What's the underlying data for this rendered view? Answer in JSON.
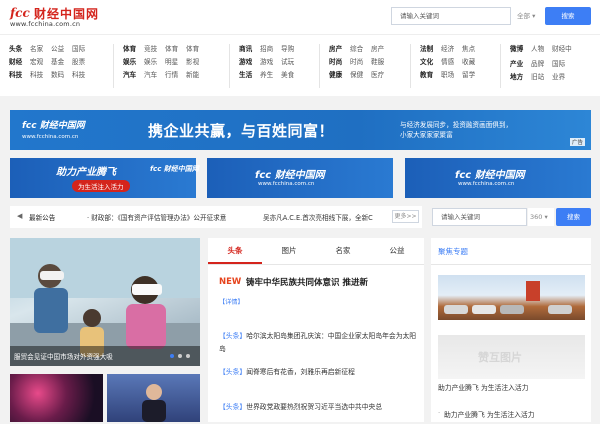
{
  "header": {
    "logo_mark": "fcc",
    "logo_text": "财经中国网",
    "logo_url": "www.fcchina.com.cn",
    "search_placeholder": "请输入关键词",
    "search_scope": "全部",
    "search_button": "搜索"
  },
  "nav": {
    "groups": [
      {
        "rows": [
          [
            "头条",
            "名家",
            "公益",
            "国际"
          ],
          [
            "财经",
            "宏观",
            "基金",
            "股票"
          ],
          [
            "科技",
            "科技",
            "数码",
            "科技"
          ]
        ]
      },
      {
        "rows": [
          [
            "体育",
            "竞技",
            "体育",
            "体育"
          ],
          [
            "娱乐",
            "娱乐",
            "明星",
            "影视"
          ],
          [
            "汽车",
            "汽车",
            "行情",
            "新能"
          ]
        ]
      },
      {
        "rows": [
          [
            "商讯",
            "招商",
            "导购"
          ],
          [
            "游戏",
            "游戏",
            "试玩"
          ],
          [
            "生活",
            "养生",
            "美食"
          ]
        ]
      },
      {
        "rows": [
          [
            "房产",
            "综合",
            "房产"
          ],
          [
            "时尚",
            "时尚",
            "鞋服"
          ],
          [
            "健康",
            "保健",
            "医疗"
          ]
        ]
      },
      {
        "rows": [
          [
            "法制",
            "经济",
            "焦点"
          ],
          [
            "文化",
            "情感",
            "收藏"
          ],
          [
            "教育",
            "职场",
            "留学"
          ]
        ]
      },
      {
        "rows": [
          [
            "微博",
            "人物",
            "财经中"
          ],
          [
            "",
            "",
            " "
          ],
          [
            "产业",
            "品牌",
            "国际"
          ],
          [
            "地方",
            "旧站",
            "业界"
          ]
        ]
      }
    ]
  },
  "banner": {
    "logo": "fcc 财经中国网",
    "url": "www.fcchina.com.cn",
    "slogan": "携企业共赢，与百姓同富！",
    "side_line_1": "与经济发展同步，投资融资画面俱到，",
    "side_line_2": "小家大家家家聚富",
    "ad_tag": "广告"
  },
  "sub_banners": {
    "one_title": "助力产业腾飞",
    "one_sub": "为生活注入活力",
    "logo": "fcc 财经中国网",
    "url": "www.fcchina.com.cn"
  },
  "notice": {
    "label": "最新公告",
    "item_1": "· 财政部：《国有资产评估管理办法》公开征求意",
    "item_2": "吴亦凡A.C.E.首次亮相线下展，全新C",
    "more": "更多>>",
    "search_placeholder": "请输入关键词",
    "search_scope": "360",
    "search_button": "搜索"
  },
  "slideshow": {
    "caption": "服贸会见证中国市场对外资强大吸"
  },
  "news": {
    "tabs": [
      "头条",
      "图片",
      "名家",
      "公益"
    ],
    "new_tag": "NEW",
    "headline": "铸牢中华民族共同体意识 推进新",
    "detail": "【详情】",
    "items": [
      {
        "tag": "【头条】",
        "text": "哈尔滨太阳岛集团孔庆滨：中国企业家太阳岛年会为太阳岛"
      },
      {
        "tag": "【头条】",
        "text": "闻脊寒后有花香，刘雅乐再启新征程"
      },
      {
        "tag": "【头条】",
        "text": "世界政党政要热烈祝贺习近平当选中共中央总"
      }
    ]
  },
  "right": {
    "title": "聚焦专题",
    "watermark": "赞互图片",
    "caption_1": "助力产业腾飞 为生活注入活力",
    "caption_2": "助力产业腾飞 为生活注入活力"
  },
  "colors": {
    "accent": "#3d7ef5",
    "brand_red": "#d4241c",
    "banner_blue": "#1f6fc2"
  }
}
